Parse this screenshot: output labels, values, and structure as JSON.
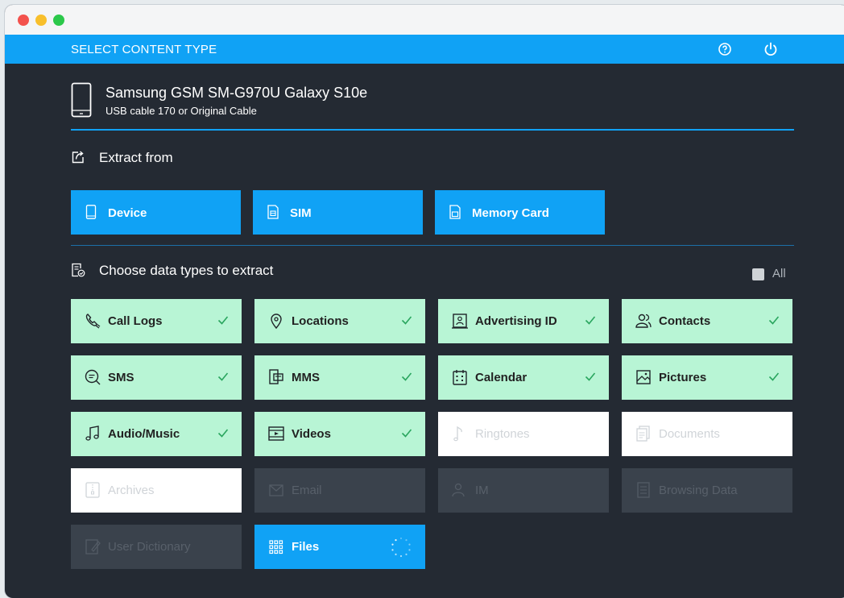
{
  "window": {
    "controls": [
      "close",
      "minimize",
      "maximize"
    ]
  },
  "appbar": {
    "title": "SELECT CONTENT TYPE",
    "help_icon": "help-icon",
    "power_icon": "power-icon"
  },
  "device": {
    "name": "Samsung GSM SM-G970U Galaxy S10e",
    "connection": "USB cable 170 or Original Cable",
    "icon": "phone-icon"
  },
  "extract": {
    "heading": "Extract from",
    "icon": "export-icon",
    "sources": [
      {
        "label": "Device",
        "icon": "phone-icon"
      },
      {
        "label": "SIM",
        "icon": "sim-icon"
      },
      {
        "label": "Memory Card",
        "icon": "memory-card-icon"
      }
    ]
  },
  "datatypes": {
    "heading": "Choose data types to extract",
    "icon": "document-check-icon",
    "all_label": "All",
    "items": [
      {
        "label": "Call Logs",
        "state": "selected",
        "icon": "call-log-icon"
      },
      {
        "label": "Locations",
        "state": "selected",
        "icon": "location-icon"
      },
      {
        "label": "Advertising ID",
        "state": "selected",
        "icon": "badge-icon"
      },
      {
        "label": "Contacts",
        "state": "selected",
        "icon": "contacts-icon"
      },
      {
        "label": "SMS",
        "state": "selected",
        "icon": "sms-icon"
      },
      {
        "label": "MMS",
        "state": "selected",
        "icon": "mms-icon"
      },
      {
        "label": "Calendar",
        "state": "selected",
        "icon": "calendar-icon"
      },
      {
        "label": "Pictures",
        "state": "selected",
        "icon": "picture-icon"
      },
      {
        "label": "Audio/Music",
        "state": "selected",
        "icon": "music-icon"
      },
      {
        "label": "Videos",
        "state": "selected",
        "icon": "video-icon"
      },
      {
        "label": "Ringtones",
        "state": "unselected",
        "icon": "note-icon"
      },
      {
        "label": "Documents",
        "state": "unselected",
        "icon": "documents-icon"
      },
      {
        "label": "Archives",
        "state": "unselected",
        "icon": "archive-icon"
      },
      {
        "label": "Email",
        "state": "disabled",
        "icon": "email-icon"
      },
      {
        "label": "IM",
        "state": "disabled",
        "icon": "im-icon"
      },
      {
        "label": "Browsing Data",
        "state": "disabled",
        "icon": "browser-icon"
      },
      {
        "label": "User Dictionary",
        "state": "disabled",
        "icon": "dictionary-icon"
      },
      {
        "label": "Files",
        "state": "loading",
        "icon": "grid-icon"
      }
    ]
  },
  "colors": {
    "accent": "#10a2f5",
    "background": "#242a33",
    "selected": "#b8f5d5",
    "check": "#2aa65f"
  }
}
